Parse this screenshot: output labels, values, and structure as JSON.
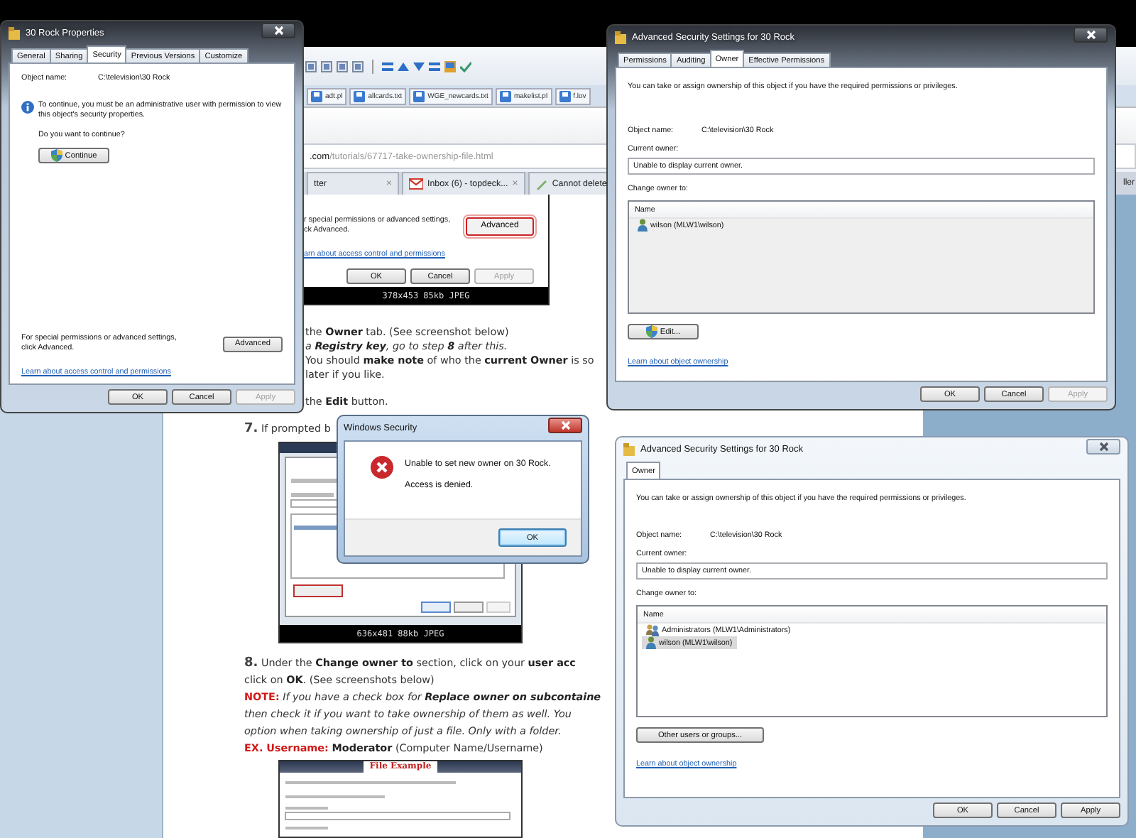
{
  "browser": {
    "bookmarks": [
      "adt.pl",
      "allcards.txt",
      "WGE_newcards.txt",
      "makelist.pl",
      "f.lov"
    ],
    "address": {
      "host": ".com",
      "path": "/tutorials/67717-take-ownership-file.html"
    },
    "tabs": [
      {
        "label": "tter",
        "close": "×",
        "kind": "plain"
      },
      {
        "label": "Inbox (6) - topdeck...",
        "close": "×",
        "kind": "mail"
      },
      {
        "label": "Cannot delete",
        "kind": "page"
      }
    ],
    "edge_tab": "ller"
  },
  "article": {
    "shot_top": {
      "lines": [
        "r special permissions or advanced settings,",
        "ck Advanced."
      ],
      "button": "Advanced",
      "link": "arn about access control and permissions",
      "buttons": [
        {
          "label": "OK",
          "disabled": false
        },
        {
          "label": "Cancel",
          "disabled": false
        },
        {
          "label": "Apply",
          "disabled": true
        }
      ],
      "caption": "378x453 85kb JPEG"
    },
    "paragraphs": [
      [
        {
          "kind": "plain",
          "text": "the **Owner** tab. (See screenshot below)"
        },
        {
          "kind": "note",
          "text": "a **Registry key**, go to step **8** after this."
        },
        {
          "kind": "plain",
          "text": "You should **make note** of who the **current Owner** is so"
        },
        {
          "kind": "plain",
          "text": "later if you like."
        }
      ],
      [
        {
          "kind": "plain",
          "text": "the **Edit** button."
        }
      ]
    ],
    "step7": {
      "number": "7.",
      "lines": [
        {
          "kind": "plain",
          "text": "If prompted b"
        }
      ]
    },
    "shot_mid": {
      "caption": "636x481 88kb JPEG"
    },
    "step8": {
      "number": "8.",
      "lines": [
        {
          "kind": "plain",
          "text": "Under the **Change owner to** section, click on your **user acc**"
        },
        {
          "kind": "plain",
          "text": "click on **OK**. (See screenshots below)"
        },
        {
          "kind": "note",
          "label": "NOTE:",
          "text": "If you have a check box for **Replace owner on subcontaine**"
        },
        {
          "kind": "note",
          "text": "then check it if you want to take ownership of them as well. You"
        },
        {
          "kind": "note",
          "text": "option when taking ownership of just a file. Only with a folder."
        },
        {
          "kind": "plain",
          "label": "EX. Username:",
          "text": "**Moderator** (Computer Name/Username)"
        }
      ]
    },
    "shot_bottom": {
      "heading": "File Example"
    }
  },
  "properties_window": {
    "title": "30 Rock Properties",
    "tabs": [
      {
        "label": "General",
        "selected": false
      },
      {
        "label": "Sharing",
        "selected": false
      },
      {
        "label": "Security",
        "selected": true
      },
      {
        "label": "Previous Versions",
        "selected": false
      },
      {
        "label": "Customize",
        "selected": false
      }
    ],
    "object_label": "Object name:",
    "object_value": "C:\\television\\30 Rock",
    "info": "To continue, you must be an administrative user with permission to view this object's security properties.",
    "question": "Do you want to continue?",
    "continue_button": {
      "label": "Continue",
      "kind": "elevated"
    },
    "advanced_text": "For special permissions or advanced settings, click Advanced.",
    "advanced_button": "Advanced",
    "link": "Learn about access control and permissions",
    "buttons": [
      {
        "label": "OK",
        "disabled": false
      },
      {
        "label": "Cancel",
        "disabled": false
      },
      {
        "label": "Apply",
        "disabled": true
      }
    ]
  },
  "owner_window_top": {
    "title": "Advanced Security Settings for 30 Rock",
    "tabs": [
      {
        "label": "Permissions",
        "selected": false
      },
      {
        "label": "Auditing",
        "selected": false
      },
      {
        "label": "Owner",
        "selected": true
      },
      {
        "label": "Effective Permissions",
        "selected": false
      }
    ],
    "intro": "You can take or assign ownership of this object if you have the required permissions or privileges.",
    "object_label": "Object name:",
    "object_value": "C:\\television\\30 Rock",
    "current_owner_label": "Current owner:",
    "current_owner_value": "Unable to display current owner.",
    "change_label": "Change owner to:",
    "list": {
      "disabled": true,
      "header": "Name",
      "rows": [
        {
          "name": "wilson (MLW1\\wilson)",
          "kind": "user",
          "selected": false
        }
      ]
    },
    "action_button": {
      "label": "Edit...",
      "kind": "elevated"
    },
    "link": "Learn about object ownership",
    "buttons": [
      {
        "label": "OK",
        "disabled": false
      },
      {
        "label": "Cancel",
        "disabled": false
      },
      {
        "label": "Apply",
        "disabled": true
      }
    ]
  },
  "security_dialog": {
    "title": "Windows Security",
    "message": "Unable to set new owner on 30 Rock.",
    "detail": "Access is denied.",
    "button": "OK"
  },
  "owner_window_bottom": {
    "title": "Advanced Security Settings for 30 Rock",
    "tabs": [
      {
        "label": "Owner",
        "selected": true
      }
    ],
    "intro": "You can take or assign ownership of this object if you have the required permissions or privileges.",
    "object_label": "Object name:",
    "object_value": "C:\\television\\30 Rock",
    "current_owner_label": "Current owner:",
    "current_owner_value": "Unable to display current owner.",
    "change_label": "Change owner to:",
    "list": {
      "disabled": false,
      "header": "Name",
      "rows": [
        {
          "name": "Administrators (MLW1\\Administrators)",
          "kind": "group",
          "selected": false
        },
        {
          "name": "wilson (MLW1\\wilson)",
          "kind": "user",
          "selected": true
        }
      ]
    },
    "action_button": {
      "label": "Other users or groups...",
      "kind": "plain"
    },
    "link": "Learn about object ownership",
    "buttons": [
      {
        "label": "OK",
        "disabled": false
      },
      {
        "label": "Cancel",
        "disabled": false
      },
      {
        "label": "Apply",
        "disabled": false
      }
    ]
  }
}
